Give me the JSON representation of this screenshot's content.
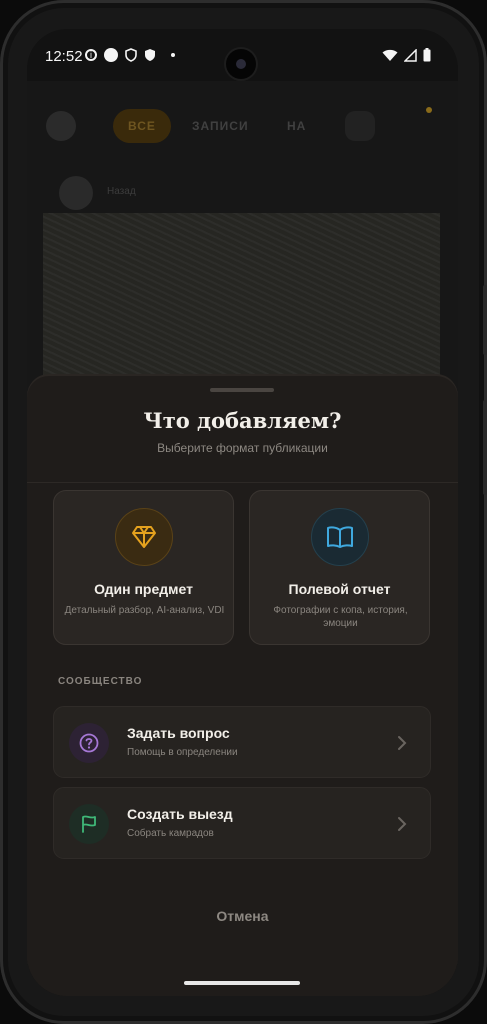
{
  "status_bar": {
    "time": "12:52"
  },
  "background_app": {
    "tabs": [
      "ВСЕ",
      "ЗАПИСИ",
      "НА"
    ],
    "post_author": "Назад"
  },
  "sheet": {
    "title": "Что добавляем?",
    "subtitle": "Выберите формат публикации",
    "cards": [
      {
        "title": "Один предмет",
        "description": "Детальный разбор, AI-анализ, VDI",
        "icon": "diamond-icon",
        "accent": "#e5a21e"
      },
      {
        "title": "Полевой отчет",
        "description": "Фотографии с копа, история, эмоции",
        "icon": "book-icon",
        "accent": "#3fa9df"
      }
    ],
    "community_label": "СООБЩЕСТВО",
    "community_rows": [
      {
        "title": "Задать вопрос",
        "subtitle": "Помощь в определении",
        "icon": "question-circle-icon",
        "accent": "#a678d6"
      },
      {
        "title": "Создать выезд",
        "subtitle": "Собрать камрадов",
        "icon": "flag-icon",
        "accent": "#3fb878"
      }
    ],
    "cancel_label": "Отмена"
  }
}
